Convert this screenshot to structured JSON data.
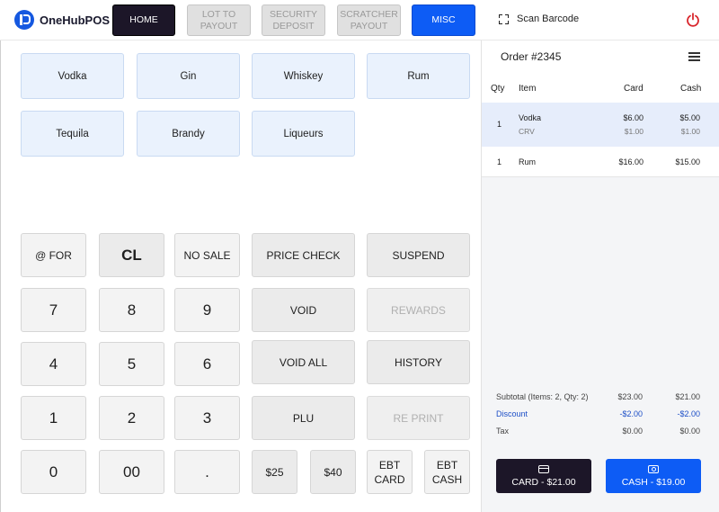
{
  "app": {
    "name": "OneHubPOS"
  },
  "nav": {
    "home": "HOME",
    "lot_to_payout": "LOT TO\nPAYOUT",
    "security_deposit": "SECURITY\nDEPOSIT",
    "scratcher_payout": "SCRATCHER\nPAYOUT",
    "misc": "MISC",
    "active": "MISC"
  },
  "scan": {
    "label": "Scan Barcode",
    "icon": "barcode-scan-icon"
  },
  "power": {
    "icon": "power-icon"
  },
  "categories": [
    "Vodka",
    "Gin",
    "Whiskey",
    "Rum",
    "Tequila",
    "Brandy",
    "Liqueurs"
  ],
  "keypad": {
    "at_for": "@ FOR",
    "cl": "CL",
    "no_sale": "NO SALE",
    "price_check": "PRICE CHECK",
    "suspend": "SUSPEND",
    "k7": "7",
    "k8": "8",
    "k9": "9",
    "void": "VOID",
    "rewards": "REWARDS",
    "k4": "4",
    "k5": "5",
    "k6": "6",
    "void_all": "VOID ALL",
    "history": "HISTORY",
    "k1": "1",
    "k2": "2",
    "k3": "3",
    "plu": "PLU",
    "re_print": "RE PRINT",
    "k0": "0",
    "k00": "00",
    "dot": ".",
    "amt25": "$25",
    "amt40": "$40",
    "ebt_card": "EBT\nCARD",
    "ebt_cash": "EBT\nCASH"
  },
  "order": {
    "title": "Order #2345",
    "columns": {
      "qty": "Qty",
      "item": "Item",
      "card": "Card",
      "cash": "Cash"
    },
    "items": [
      {
        "qty": "1",
        "name": "Vodka",
        "card": "$6.00",
        "cash": "$5.00",
        "sub_name": "CRV",
        "sub_card": "$1.00",
        "sub_cash": "$1.00",
        "selected": true
      },
      {
        "qty": "1",
        "name": "Rum",
        "card": "$16.00",
        "cash": "$15.00"
      }
    ],
    "subtotal": {
      "label": "Subtotal (Items: 2, Qty: 2)",
      "card": "$23.00",
      "cash": "$21.00"
    },
    "discount": {
      "label": "Discount",
      "card": "-$2.00",
      "cash": "-$2.00"
    },
    "tax": {
      "label": "Tax",
      "card": "$0.00",
      "cash": "$0.00"
    },
    "pay_card": "CARD - $21.00",
    "pay_cash": "CASH - $19.00"
  },
  "colors": {
    "brand_blue": "#0d5cf5",
    "dark": "#1c1628",
    "category_bg": "#eaf2fd",
    "selected_row": "#e6edfb",
    "power_red": "#d9262c"
  }
}
